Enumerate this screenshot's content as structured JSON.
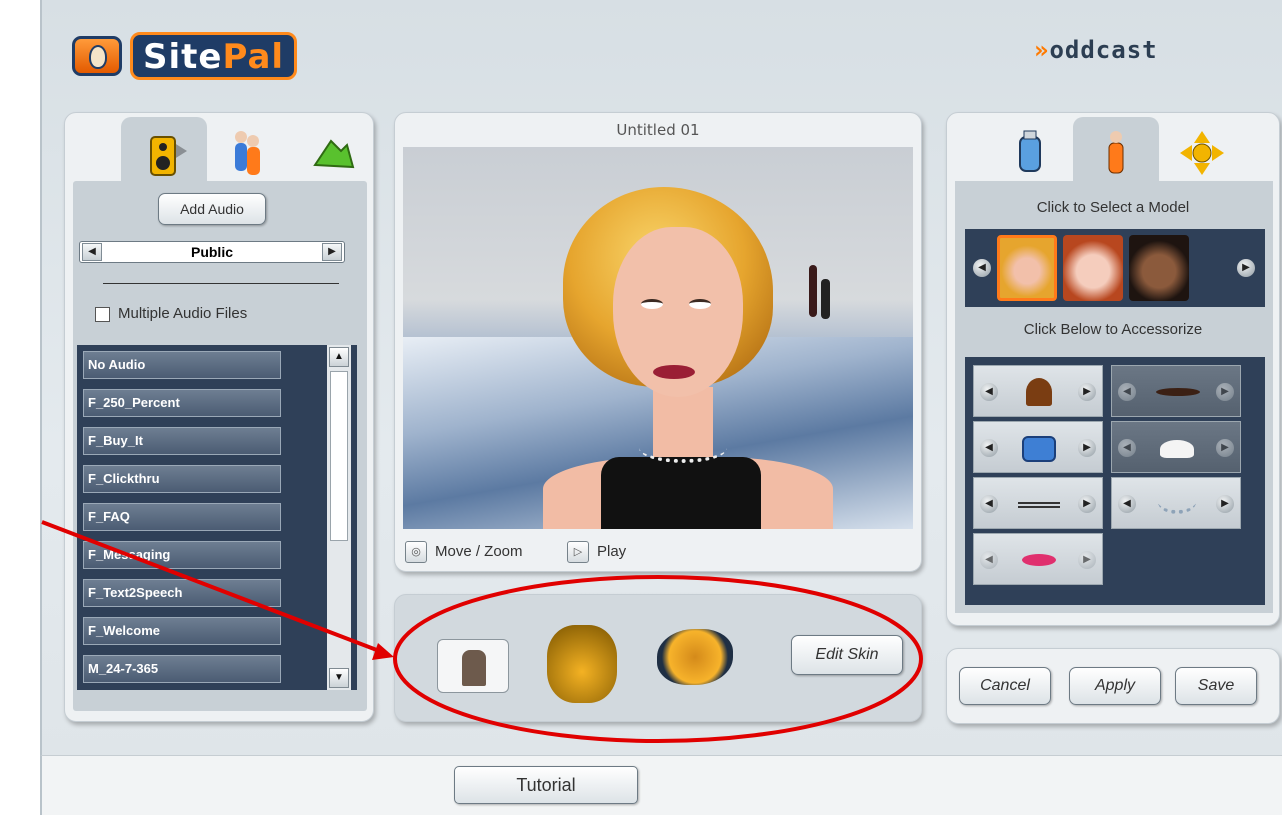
{
  "logo": {
    "text_a": "Site",
    "text_b": "Pal"
  },
  "brand": {
    "oddcast": "oddcast"
  },
  "left_panel": {
    "tabs": [
      {
        "name": "audio-tab",
        "icon": "speaker-icon"
      },
      {
        "name": "voice-tab",
        "icon": "people-icon"
      },
      {
        "name": "background-tab",
        "icon": "mountain-icon"
      }
    ],
    "add_audio_label": "Add Audio",
    "folder": {
      "value": "Public",
      "prev": "◀",
      "next": "▶"
    },
    "multiple_audio_label": "Multiple Audio Files",
    "audio_items": [
      "No Audio",
      "F_250_Percent",
      "F_Buy_It",
      "F_Clickthru",
      "F_FAQ",
      "F_Messaging",
      "F_Text2Speech",
      "F_Welcome",
      "M_24-7-365"
    ],
    "scroll_up": "▲",
    "scroll_down": "▼"
  },
  "stage": {
    "title": "Untitled 01",
    "move_zoom_label": "Move / Zoom",
    "play_label": "Play",
    "move_zoom_icon": "move-zoom-icon",
    "play_icon": "play-icon"
  },
  "skin": {
    "edit_skin_label": "Edit Skin"
  },
  "right_panel": {
    "select_model_label": "Click to Select a Model",
    "accessorize_label": "Click Below to Accessorize",
    "arrow_left": "◀",
    "arrow_right": "▶",
    "accessories": [
      "hair",
      "mustache",
      "shirt",
      "cap",
      "glasses",
      "necklace",
      "lips"
    ]
  },
  "actions": {
    "cancel_label": "Cancel",
    "apply_label": "Apply",
    "save_label": "Save"
  },
  "footer": {
    "tutorial_label": "Tutorial"
  },
  "colors": {
    "accent": "#ff8a1c",
    "panel_dark": "#2f4058",
    "annotation": "#e00000"
  }
}
